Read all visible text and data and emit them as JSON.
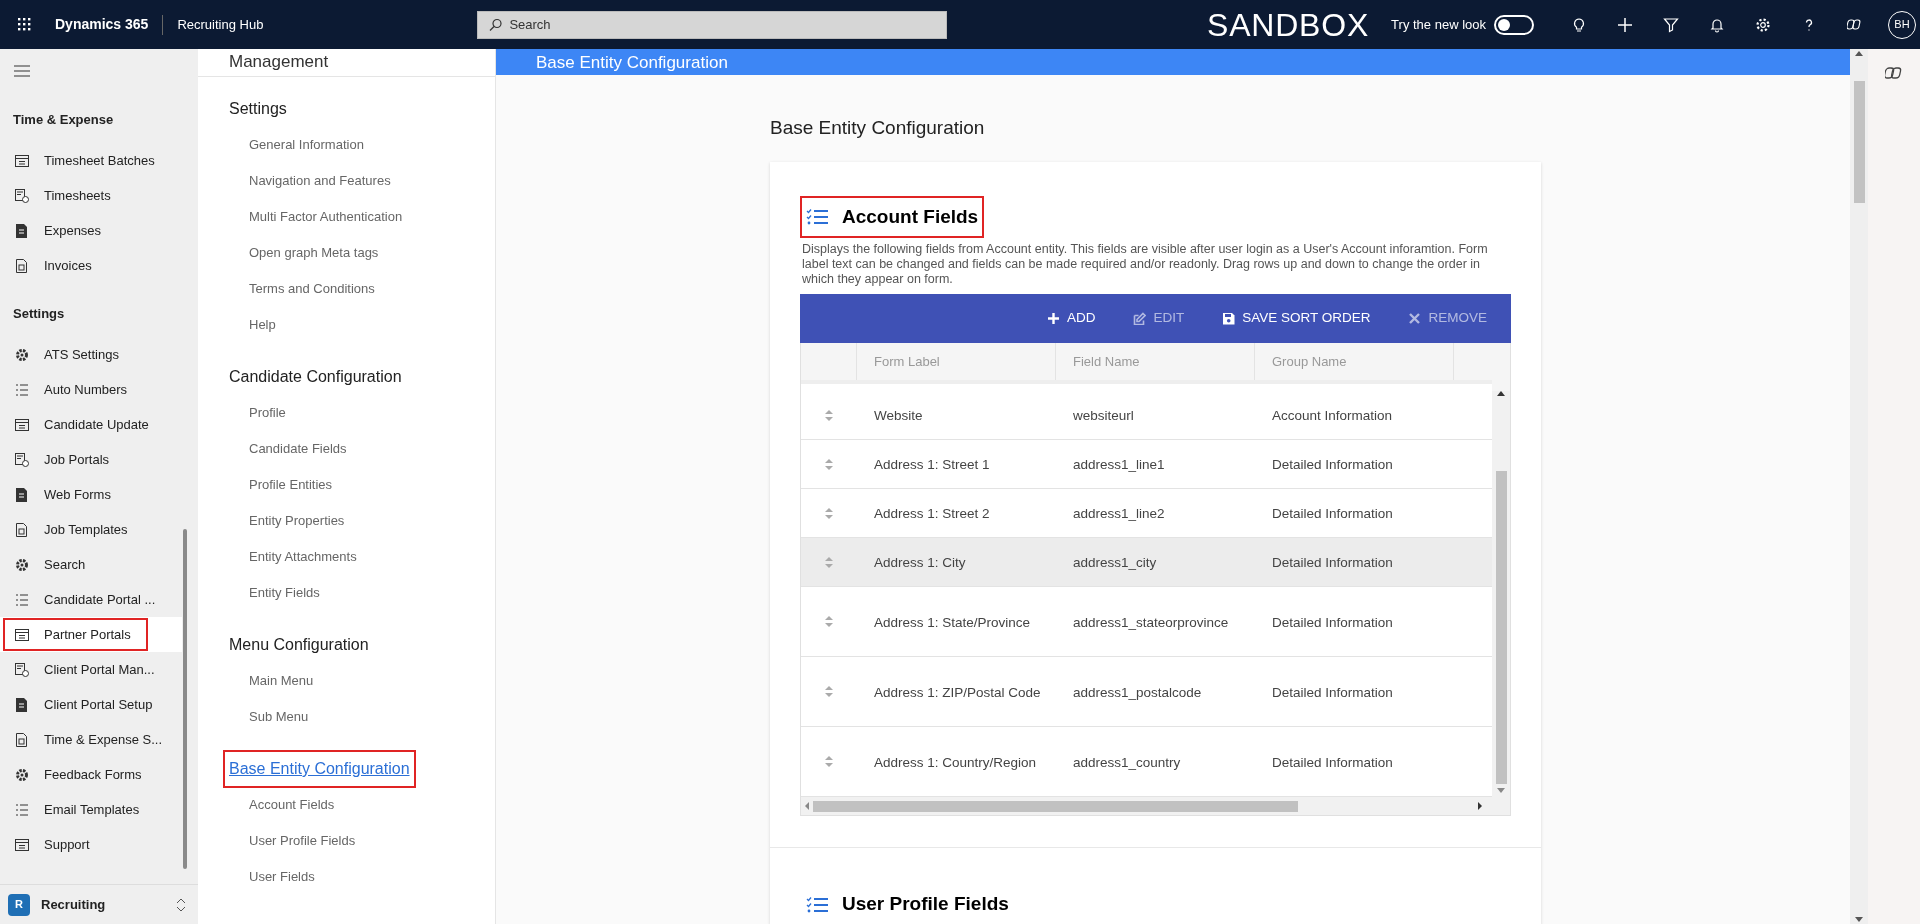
{
  "top_bar": {
    "app_name": "Dynamics 365",
    "area": "Recruiting Hub",
    "search": {
      "placeholder": "Search"
    },
    "environment": "SANDBOX",
    "new_look": {
      "label": "Try the new look",
      "on": false
    },
    "avatar": "BH"
  },
  "sidebar": {
    "groups": [
      {
        "title": "Time & Expense",
        "items": [
          {
            "label": "Timesheet Batches",
            "selected": false,
            "highlighted": false
          },
          {
            "label": "Timesheets",
            "selected": false,
            "highlighted": false
          },
          {
            "label": "Expenses",
            "selected": false,
            "highlighted": false
          },
          {
            "label": "Invoices",
            "selected": false,
            "highlighted": false
          }
        ]
      },
      {
        "title": "Settings",
        "items": [
          {
            "label": "ATS Settings",
            "selected": false,
            "highlighted": false
          },
          {
            "label": "Auto Numbers",
            "selected": false,
            "highlighted": false
          },
          {
            "label": "Candidate Update",
            "selected": false,
            "highlighted": false
          },
          {
            "label": "Job Portals",
            "selected": false,
            "highlighted": false
          },
          {
            "label": "Web Forms",
            "selected": false,
            "highlighted": false
          },
          {
            "label": "Job Templates",
            "selected": false,
            "highlighted": false
          },
          {
            "label": "Search",
            "selected": false,
            "highlighted": false
          },
          {
            "label": "Candidate Portal ...",
            "selected": false,
            "highlighted": false
          },
          {
            "label": "Partner Portals",
            "selected": true,
            "highlighted": true
          },
          {
            "label": "Client Portal Man...",
            "selected": false,
            "highlighted": false
          },
          {
            "label": "Client Portal Setup",
            "selected": false,
            "highlighted": false
          },
          {
            "label": "Time & Expense S...",
            "selected": false,
            "highlighted": false
          },
          {
            "label": "Feedback Forms",
            "selected": false,
            "highlighted": false
          },
          {
            "label": "Email Templates",
            "selected": false,
            "highlighted": false
          },
          {
            "label": "Support",
            "selected": false,
            "highlighted": false
          }
        ]
      }
    ],
    "footer": {
      "badge": "R",
      "label": "Recruiting"
    }
  },
  "settings_nav": {
    "title": "Management",
    "sections": [
      {
        "title": "Settings",
        "selected": false,
        "highlighted": false,
        "items": [
          "General Information",
          "Navigation and Features",
          "Multi Factor Authentication",
          "Open graph Meta tags",
          "Terms and Conditions",
          "Help"
        ]
      },
      {
        "title": "Candidate Configuration",
        "selected": false,
        "highlighted": false,
        "items": [
          "Profile",
          "Candidate Fields",
          "Profile Entities",
          "Entity Properties",
          "Entity Attachments",
          "Entity Fields"
        ]
      },
      {
        "title": "Menu Configuration",
        "selected": false,
        "highlighted": false,
        "items": [
          "Main Menu",
          "Sub Menu"
        ]
      },
      {
        "title": "Base Entity Configuration",
        "selected": true,
        "highlighted": true,
        "items": [
          "Account Fields",
          "User Profile Fields",
          "User Fields"
        ]
      }
    ]
  },
  "main": {
    "banner": "Base Entity Configuration",
    "heading": "Base Entity Configuration",
    "account_fields": {
      "title": "Account Fields",
      "highlighted": true,
      "description": "Displays the following fields from Account entity. This fields are visible after user login as a User's Account inforamtion. Form label text can be changed and fields can be made required and/or readonly. Drag rows up and down to change the order in which they appear on form.",
      "toolbar": [
        {
          "kind": "add",
          "label": "ADD",
          "disabled": false
        },
        {
          "kind": "edit",
          "label": "EDIT",
          "disabled": true
        },
        {
          "kind": "save",
          "label": "SAVE SORT ORDER",
          "disabled": false
        },
        {
          "kind": "remove",
          "label": "REMOVE",
          "disabled": true
        }
      ],
      "table": {
        "columns": [
          "Form Label",
          "Field Name",
          "Group Name"
        ],
        "rows": [
          {
            "form_label": "Website",
            "field_name": "websiteurl",
            "group_name": "Account Information",
            "hovered": false
          },
          {
            "form_label": "Address 1: Street 1",
            "field_name": "address1_line1",
            "group_name": "Detailed Information",
            "hovered": false
          },
          {
            "form_label": "Address 1: Street 2",
            "field_name": "address1_line2",
            "group_name": "Detailed Information",
            "hovered": false
          },
          {
            "form_label": "Address 1: City",
            "field_name": "address1_city",
            "group_name": "Detailed Information",
            "hovered": true
          },
          {
            "form_label": "Address 1: State/Province",
            "field_name": "address1_stateorprovince",
            "group_name": "Detailed Information",
            "hovered": false
          },
          {
            "form_label": "Address 1: ZIP/Postal Code",
            "field_name": "address1_postalcode",
            "group_name": "Detailed Information",
            "hovered": false
          },
          {
            "form_label": "Address 1: Country/Region",
            "field_name": "address1_country",
            "group_name": "Detailed Information",
            "hovered": false
          }
        ]
      }
    },
    "next_section": {
      "title": "User Profile Fields"
    }
  }
}
